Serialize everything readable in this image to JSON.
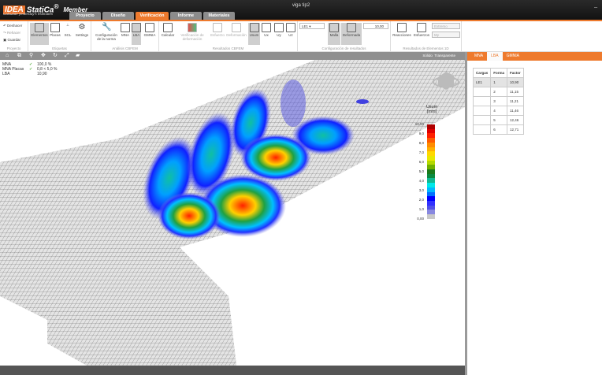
{
  "app": {
    "logo": "IDEA StatiCa",
    "edition": "Member",
    "slogan": "Calculate yesterday's estimates",
    "window_title": "viga tip2",
    "minimize": "_"
  },
  "tabs": [
    "Proyecto",
    "Diseño",
    "Verificación",
    "Informe",
    "Materiales"
  ],
  "ribbon": {
    "proyecto": {
      "label": "Proyecto",
      "undo": "Deshacer",
      "redo": "Rehacer",
      "save": "Guardar"
    },
    "etiquetas": {
      "label": "Etiquetas",
      "items": [
        "Elementos",
        "Placas",
        "SCL",
        "Settings"
      ]
    },
    "analisis": {
      "label": "Análisis CBFEM",
      "items": [
        "Configuración de la norma",
        "MNA",
        "LBA",
        "GMNIA"
      ]
    },
    "resultados": {
      "label": "Resultados CBFEM",
      "items": [
        "Calcular",
        "Verificación de deformación",
        "Esfuerzo",
        "Deformación",
        "Usum",
        "Ux",
        "Uy",
        "Uz"
      ]
    },
    "config": {
      "label": "Configuración de resultados",
      "load_case": "LE1",
      "items": [
        "Malla",
        "Deformada"
      ],
      "scale": "10,00"
    },
    "elementos1d": {
      "label": "Resultados de Elementos 1D",
      "items": [
        "Reacciones",
        "Esfuerzos"
      ],
      "select1": "Extremo",
      "select2": "My"
    }
  },
  "view": {
    "modes": [
      "Sólido",
      "Transparente"
    ]
  },
  "checks": [
    {
      "name": "MNA",
      "value": "100,0 %",
      "ok": true
    },
    {
      "name": "MNA Placas",
      "value": "0,8 < 5,0 %",
      "ok": true
    },
    {
      "name": "LBA",
      "value": "10,90",
      "ok": false
    }
  ],
  "legend": {
    "title": "Usum",
    "unit": "[mm]",
    "labels": [
      "10,00",
      "9,0",
      "8,0",
      "7,0",
      "6,0",
      "5,0",
      "4,0",
      "3,0",
      "2,0",
      "1,0",
      "0,00"
    ],
    "colors": [
      "#b00000",
      "#e00000",
      "#ff2000",
      "#ff5a00",
      "#ff8c00",
      "#ffb000",
      "#ffd800",
      "#e8e800",
      "#b4d800",
      "#70b000",
      "#1a7a1a",
      "#0a8a40",
      "#10b890",
      "#00e8e8",
      "#00b8ff",
      "#0070ff",
      "#0000ff",
      "#3030ff",
      "#5050e8",
      "#8888e0",
      "#c8c8c8"
    ]
  },
  "panel": {
    "tabs": [
      "MNA",
      "LBA",
      "GMNIA"
    ],
    "active_tab": "LBA",
    "columns": [
      "Cargas",
      "Forma",
      "Factor"
    ],
    "rows": [
      [
        "LE1",
        "1",
        "10,90"
      ],
      [
        "",
        "2",
        "11,15"
      ],
      [
        "",
        "3",
        "11,21"
      ],
      [
        "",
        "4",
        "11,46"
      ],
      [
        "",
        "5",
        "12,46"
      ],
      [
        "",
        "6",
        "12,71"
      ]
    ]
  }
}
